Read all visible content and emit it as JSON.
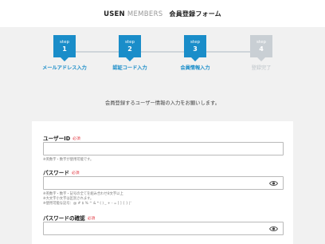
{
  "header": {
    "brand_primary": "USEN",
    "brand_secondary": "MEMBERS",
    "form_title": "会員登録フォーム"
  },
  "steps": [
    {
      "word": "step",
      "number": "1",
      "label": "メールアドレス入力",
      "state": "active"
    },
    {
      "word": "step",
      "number": "2",
      "label": "認証コード入力",
      "state": "active"
    },
    {
      "word": "step",
      "number": "3",
      "label": "会員情報入力",
      "state": "active"
    },
    {
      "word": "step",
      "number": "4",
      "label": "登録完了",
      "state": "inactive"
    }
  ],
  "intro_text": "会員登録するユーザー情報の入力をお願いします。",
  "form": {
    "required_mark": "必須",
    "user_id": {
      "label": "ユーザーID",
      "value": "",
      "note": "※英数字・数字が使用可能です。"
    },
    "password": {
      "label": "パスワード",
      "value": "",
      "note_line1": "※英数字・数字・記号の全てを組み合わせ8文字以上",
      "note_line2": "※大文字小文字は区別されます。",
      "note_line3": "※使用可能な記号：@ # $ % ^ & * ( ) _ + - = [ ] { } |'"
    },
    "password_confirm": {
      "label": "パスワードの確認",
      "value": ""
    }
  },
  "icons": {
    "password_toggle": "eye-icon"
  },
  "colors": {
    "accent": "#1a8dc9",
    "inactive": "#c9cfd4",
    "required": "#e0303a",
    "background": "#f1f1f1"
  }
}
